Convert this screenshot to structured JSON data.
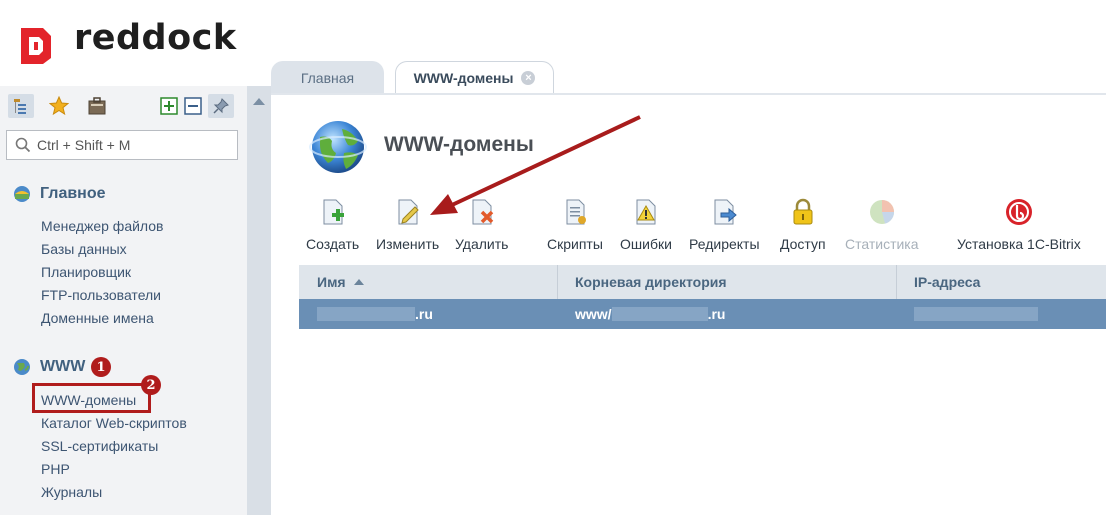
{
  "brand": {
    "name": "reddock",
    "color": "#e3242b"
  },
  "sidebar": {
    "search_placeholder": "Ctrl + Shift + M",
    "sections": [
      {
        "title": "Главное",
        "items": [
          "Менеджер файлов",
          "Базы данных",
          "Планировщик",
          "FTP-пользователи",
          "Доменные имена"
        ]
      },
      {
        "title": "WWW",
        "items": [
          "WWW-домены",
          "Каталог Web-скриптов",
          "SSL-сертификаты",
          "PHP",
          "Журналы"
        ]
      }
    ],
    "badges": [
      "1",
      "2"
    ]
  },
  "tabs": [
    {
      "label": "Главная",
      "active": false
    },
    {
      "label": "WWW-домены",
      "active": true
    }
  ],
  "page": {
    "title": "WWW-домены"
  },
  "toolbar": [
    {
      "label": "Создать",
      "icon": "create-icon",
      "enabled": true
    },
    {
      "label": "Изменить",
      "icon": "edit-icon",
      "enabled": true
    },
    {
      "label": "Удалить",
      "icon": "delete-icon",
      "enabled": true
    },
    {
      "label": "Скрипты",
      "icon": "scripts-icon",
      "enabled": true
    },
    {
      "label": "Ошибки",
      "icon": "errors-icon",
      "enabled": true
    },
    {
      "label": "Редиректы",
      "icon": "redirects-icon",
      "enabled": true
    },
    {
      "label": "Доступ",
      "icon": "lock-icon",
      "enabled": true
    },
    {
      "label": "Статистика",
      "icon": "pie-chart-icon",
      "enabled": false
    },
    {
      "label": "Установка 1С-Bitrix",
      "icon": "bitrix-icon",
      "enabled": true
    }
  ],
  "table": {
    "columns": [
      "Имя",
      "Корневая директория",
      "IP-адреса"
    ],
    "rows": [
      {
        "name_suffix": ".ru",
        "root_prefix": "www/",
        "root_suffix": ".ru",
        "ip": ""
      }
    ]
  },
  "colors": {
    "accent_red": "#b01c1c",
    "row_selected": "#6a8fb5",
    "header_bg": "#dfe5eb"
  }
}
